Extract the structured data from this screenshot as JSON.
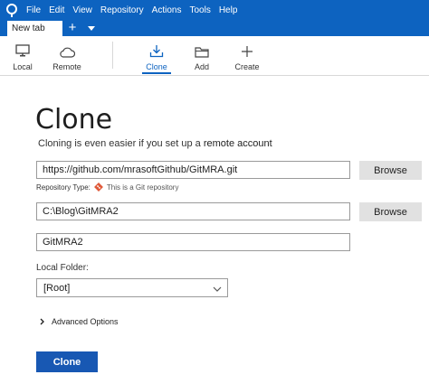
{
  "menu": {
    "items": [
      "File",
      "Edit",
      "View",
      "Repository",
      "Actions",
      "Tools",
      "Help"
    ]
  },
  "tabs": {
    "active_label": "New tab",
    "add_label": "+"
  },
  "toolbar": {
    "items": [
      {
        "label": "Local",
        "icon": "monitor-icon"
      },
      {
        "label": "Remote",
        "icon": "cloud-icon"
      },
      {
        "label": "Clone",
        "icon": "download-icon",
        "active": true
      },
      {
        "label": "Add",
        "icon": "folder-icon"
      },
      {
        "label": "Create",
        "icon": "plus-icon"
      }
    ]
  },
  "clone": {
    "title": "Clone",
    "hint_prefix": "Cloning is even easier if you set up a",
    "hint_link": "remote account",
    "source_url": "https://github.com/mrasoftGithub/GitMRA.git",
    "repo_type_label": "Repository Type:",
    "repo_type_value": "This is a Git repository",
    "destination_path": "C:\\Blog\\GitMRA2",
    "name": "GitMRA2",
    "browse_label": "Browse",
    "local_folder_label": "Local Folder:",
    "local_folder_value": "[Root]",
    "advanced_label": "Advanced Options",
    "submit_label": "Clone"
  },
  "colors": {
    "accent": "#0d63c0",
    "button_primary": "#1858b3",
    "git_icon": "#e05a3a"
  }
}
